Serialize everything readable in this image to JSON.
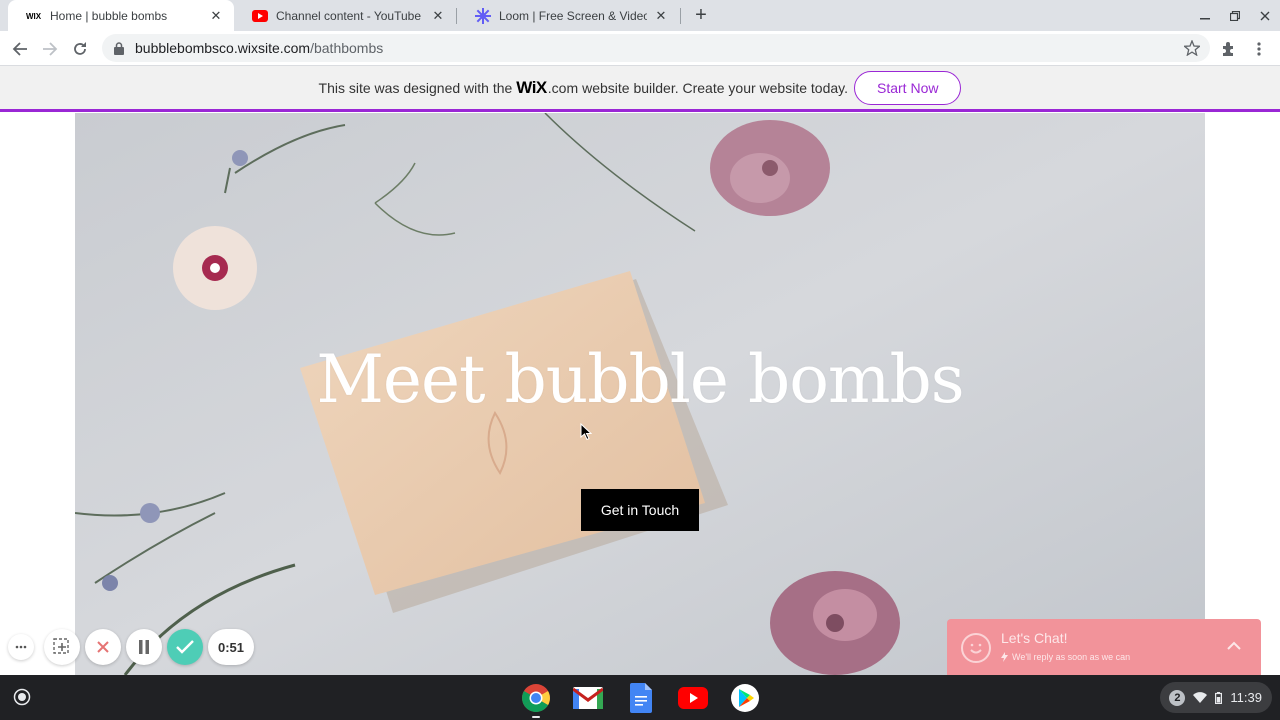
{
  "tabs": [
    {
      "title": "Home | bubble bombs",
      "favicon": "wix-icon",
      "active": true
    },
    {
      "title": "Channel content - YouTube Studio",
      "favicon": "youtube-icon",
      "active": false
    },
    {
      "title": "Loom | Free Screen & Video Recording",
      "favicon": "loom-icon",
      "active": false
    }
  ],
  "address": {
    "domain": "bubblebombsco.wixsite.com",
    "path": "/bathbombs"
  },
  "wix_banner": {
    "prefix": "This site was designed with the",
    "logo": "WiX",
    "dotcom": ".com",
    "suffix": "website builder. Create your website today.",
    "button": "Start Now",
    "accent": "#9a27d5"
  },
  "hero": {
    "title": "Meet bubble bombs",
    "cta": "Get in Touch"
  },
  "loom": {
    "timer": "0:51"
  },
  "chat": {
    "title": "Let's Chat!",
    "subtitle": "We'll reply as soon as we can",
    "color": "#f2939a"
  },
  "shelf": {
    "apps": [
      "chrome-icon",
      "gmail-icon",
      "docs-icon",
      "youtube-icon",
      "play-store-icon"
    ],
    "notifications": "2",
    "time": "11:39"
  }
}
